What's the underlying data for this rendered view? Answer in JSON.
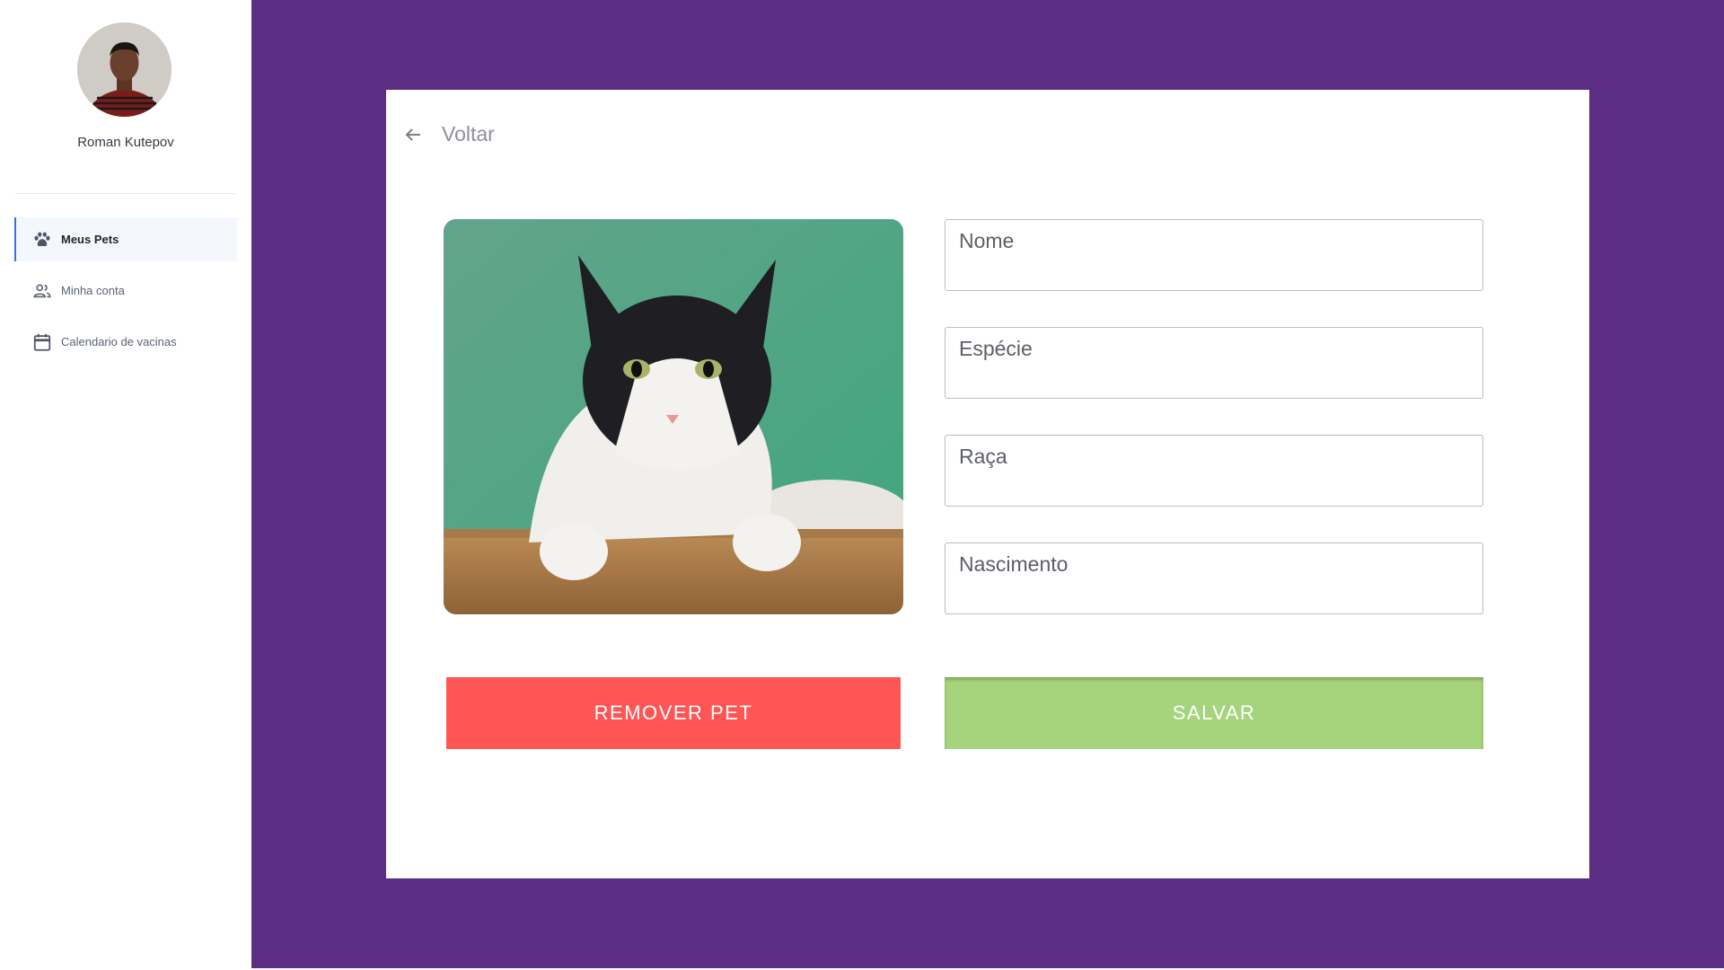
{
  "user": {
    "name": "Roman Kutepov"
  },
  "sidebar": {
    "items": [
      {
        "label": "Meus Pets",
        "icon": "paw-icon",
        "active": true
      },
      {
        "label": "Minha conta",
        "icon": "people-icon",
        "active": false
      },
      {
        "label": "Calendario de vacinas",
        "icon": "calendar-icon",
        "active": false
      }
    ]
  },
  "card": {
    "back_label": "Voltar",
    "fields": [
      {
        "placeholder": "Nome",
        "value": ""
      },
      {
        "placeholder": "Espécie",
        "value": ""
      },
      {
        "placeholder": "Raça",
        "value": ""
      },
      {
        "placeholder": "Nascimento",
        "value": ""
      }
    ],
    "remove_label": "REMOVER PET",
    "save_label": "SALVAR"
  },
  "colors": {
    "main_bg": "#5b2d83",
    "remove_button": "#fe5555",
    "save_button": "#a6d47d",
    "active_accent": "#3f6fd1"
  }
}
